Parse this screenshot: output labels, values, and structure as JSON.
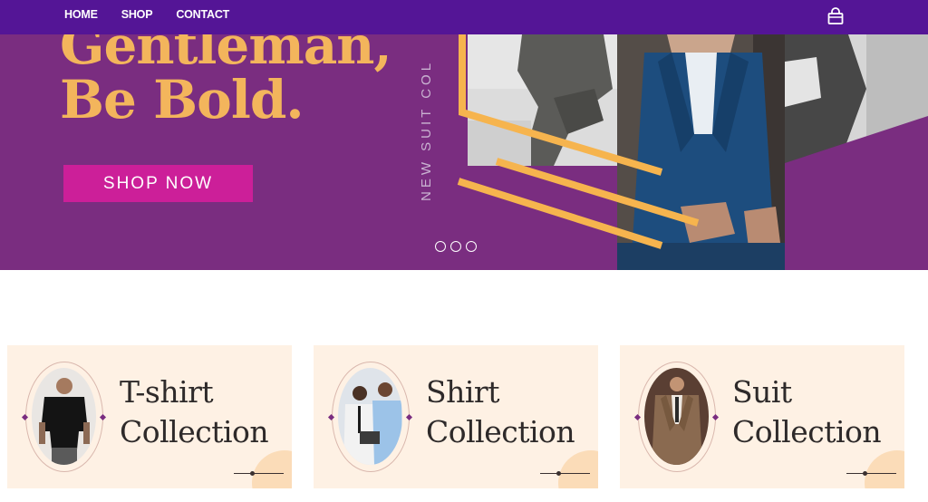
{
  "nav": {
    "links": [
      "HOME",
      "SHOP",
      "CONTACT"
    ],
    "cart_icon": "shopping-bag-icon"
  },
  "hero": {
    "headline_line1": "Gentleman,",
    "headline_line2": "Be Bold.",
    "cta_label": "SHOP NOW",
    "vertical_text": "NEW SUIT COL",
    "carousel_dot_count": 3
  },
  "collections": [
    {
      "line1": "T-shirt",
      "line2": "Collection"
    },
    {
      "line1": "Shirt",
      "line2": "Collection"
    },
    {
      "line1": "Suit",
      "line2": "Collection"
    }
  ],
  "colors": {
    "nav_bg": "#541596",
    "hero_bg": "#7a2d80",
    "headline": "#f3b55c",
    "cta_bg": "#cc1f99",
    "accent_stripe": "#f6b44e",
    "card_bg": "#fef1e4"
  }
}
